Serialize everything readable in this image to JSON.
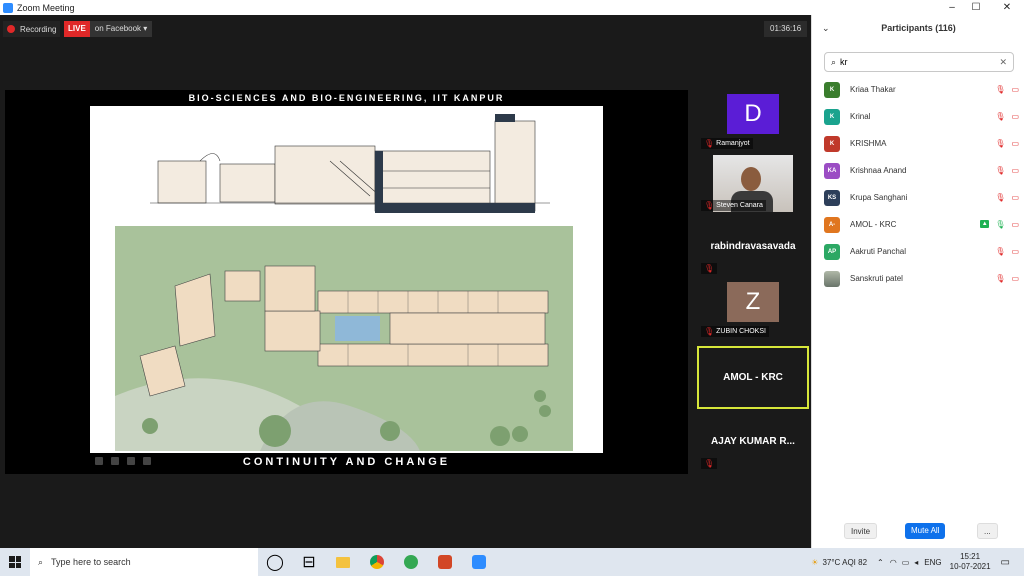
{
  "window": {
    "title": "Zoom Meeting",
    "controls": [
      "–",
      "☐",
      "✕"
    ]
  },
  "meeting": {
    "recording_label": "Recording",
    "live_label": "LIVE",
    "live_platform": "on Facebook ▾",
    "timer": "01:36:16"
  },
  "slide": {
    "header": "BIO-SCIENCES AND BIO-ENGINEERING, IIT KANPUR",
    "footer": "CONTINUITY AND CHANGE"
  },
  "gallery": [
    {
      "name": "Ramanjyot",
      "avatar": "D",
      "avatar_color": "#5b1dd6",
      "kind": "avatar"
    },
    {
      "name": "Steven Canara",
      "kind": "video"
    },
    {
      "name": "",
      "big": "rabindravasavada",
      "kind": "text"
    },
    {
      "name": "ZUBIN CHOKSI",
      "avatar": "Z",
      "avatar_color": "#8b6a5a",
      "kind": "avatar"
    },
    {
      "name": "",
      "big": "AMOL - KRC",
      "kind": "text",
      "active": true
    },
    {
      "name": "",
      "big": "AJAY KUMAR R...",
      "kind": "text"
    }
  ],
  "participants": {
    "title": "Participants (116)",
    "search_value": "kr",
    "list": [
      {
        "initials": "K",
        "name": "Kriaa Thakar",
        "color": "#3a7d2d"
      },
      {
        "initials": "K",
        "name": "Krinal",
        "color": "#1aa38e"
      },
      {
        "initials": "K",
        "name": "KRISHMA",
        "color": "#c0392b"
      },
      {
        "initials": "KA",
        "name": "Krishnaa Anand",
        "color": "#9b4dc4"
      },
      {
        "initials": "KS",
        "name": "Krupa Sanghani",
        "color": "#2d3f5a"
      },
      {
        "initials": "A-",
        "name": "AMOL - KRC",
        "color": "#e0761f",
        "host": true
      },
      {
        "initials": "AP",
        "name": "Aakruti Panchal",
        "color": "#2ca864"
      },
      {
        "initials": "",
        "name": "Sanskruti patel",
        "color": "#7a8a7a",
        "photo": true
      }
    ],
    "invite_label": "Invite",
    "mute_all_label": "Mute All",
    "more_label": "..."
  },
  "taskbar": {
    "search_placeholder": "Type here to search",
    "weather": "37°C AQI 82",
    "language": "ENG",
    "time": "15:21",
    "date": "10-07-2021"
  }
}
